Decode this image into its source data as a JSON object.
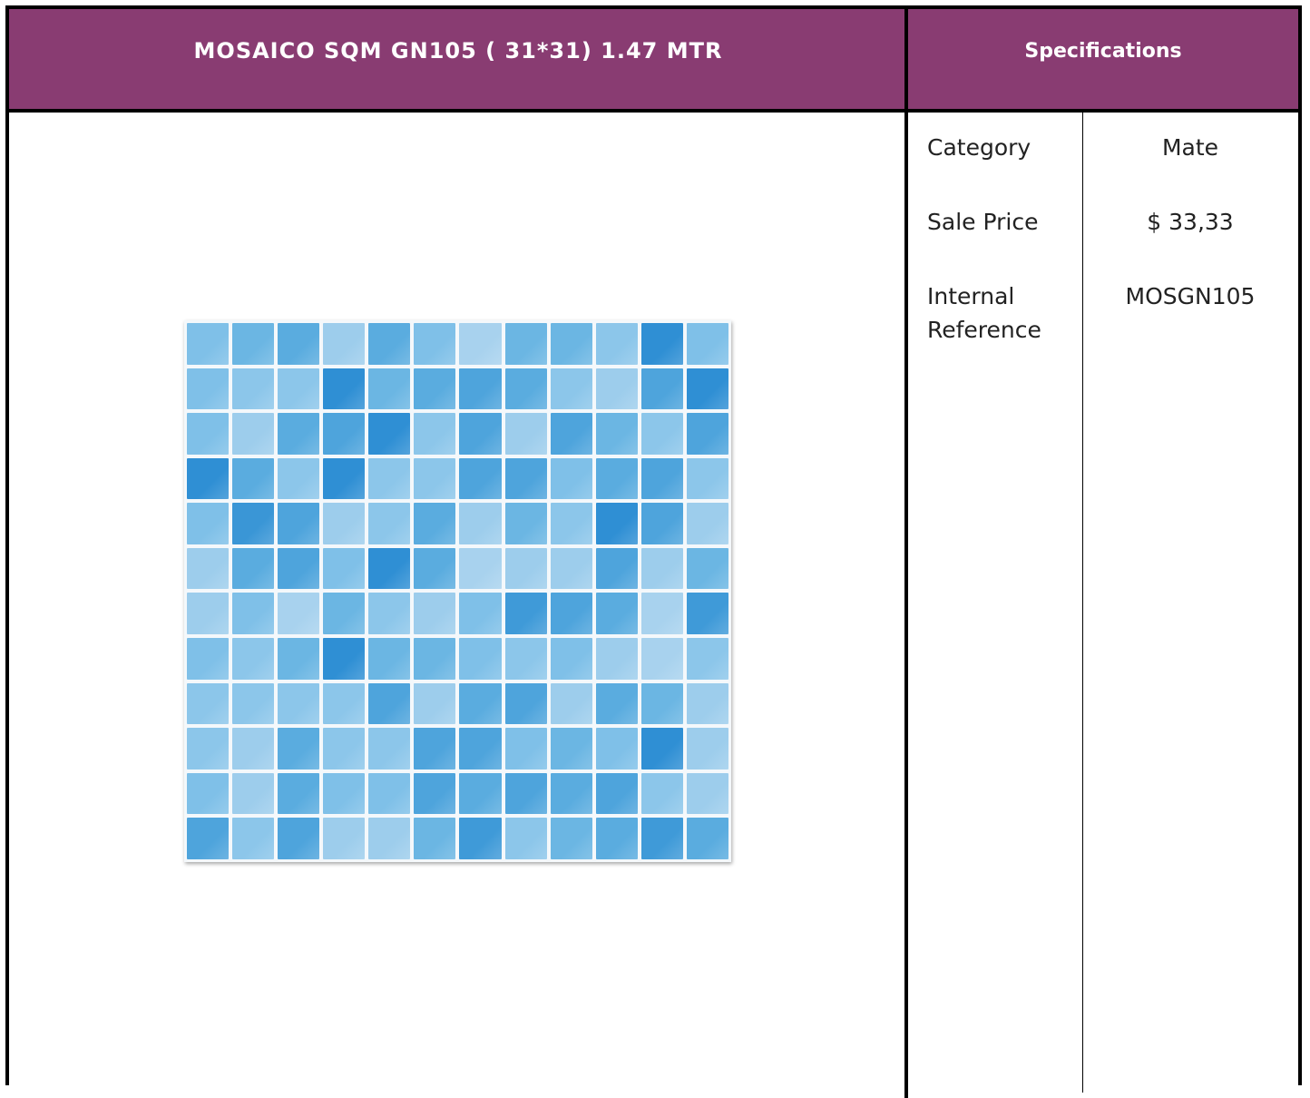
{
  "product": {
    "title": "MOSAICO SQM GN105 ( 31*31) 1.47 MTR",
    "image_label": "blue-mosaic-tile-sheet"
  },
  "specifications": {
    "heading": "Specifications",
    "rows": [
      {
        "label": "Category",
        "value": "Mate"
      },
      {
        "label": "Sale Price",
        "value": "$ 33,33"
      },
      {
        "label": "Internal Reference",
        "value": "MOSGN105"
      }
    ]
  },
  "colors": {
    "header_bg": "#893c72",
    "header_text": "#ffffff",
    "border": "#000000",
    "tile_palette": [
      "#6bb6e3",
      "#5aacdf",
      "#7fc0e8",
      "#8cc6ea",
      "#4ea4dc",
      "#9dcdec",
      "#3f9ad8",
      "#2f8fd4",
      "#a8d2ee"
    ]
  },
  "mosaic": {
    "rows": 12,
    "cols": 12
  }
}
